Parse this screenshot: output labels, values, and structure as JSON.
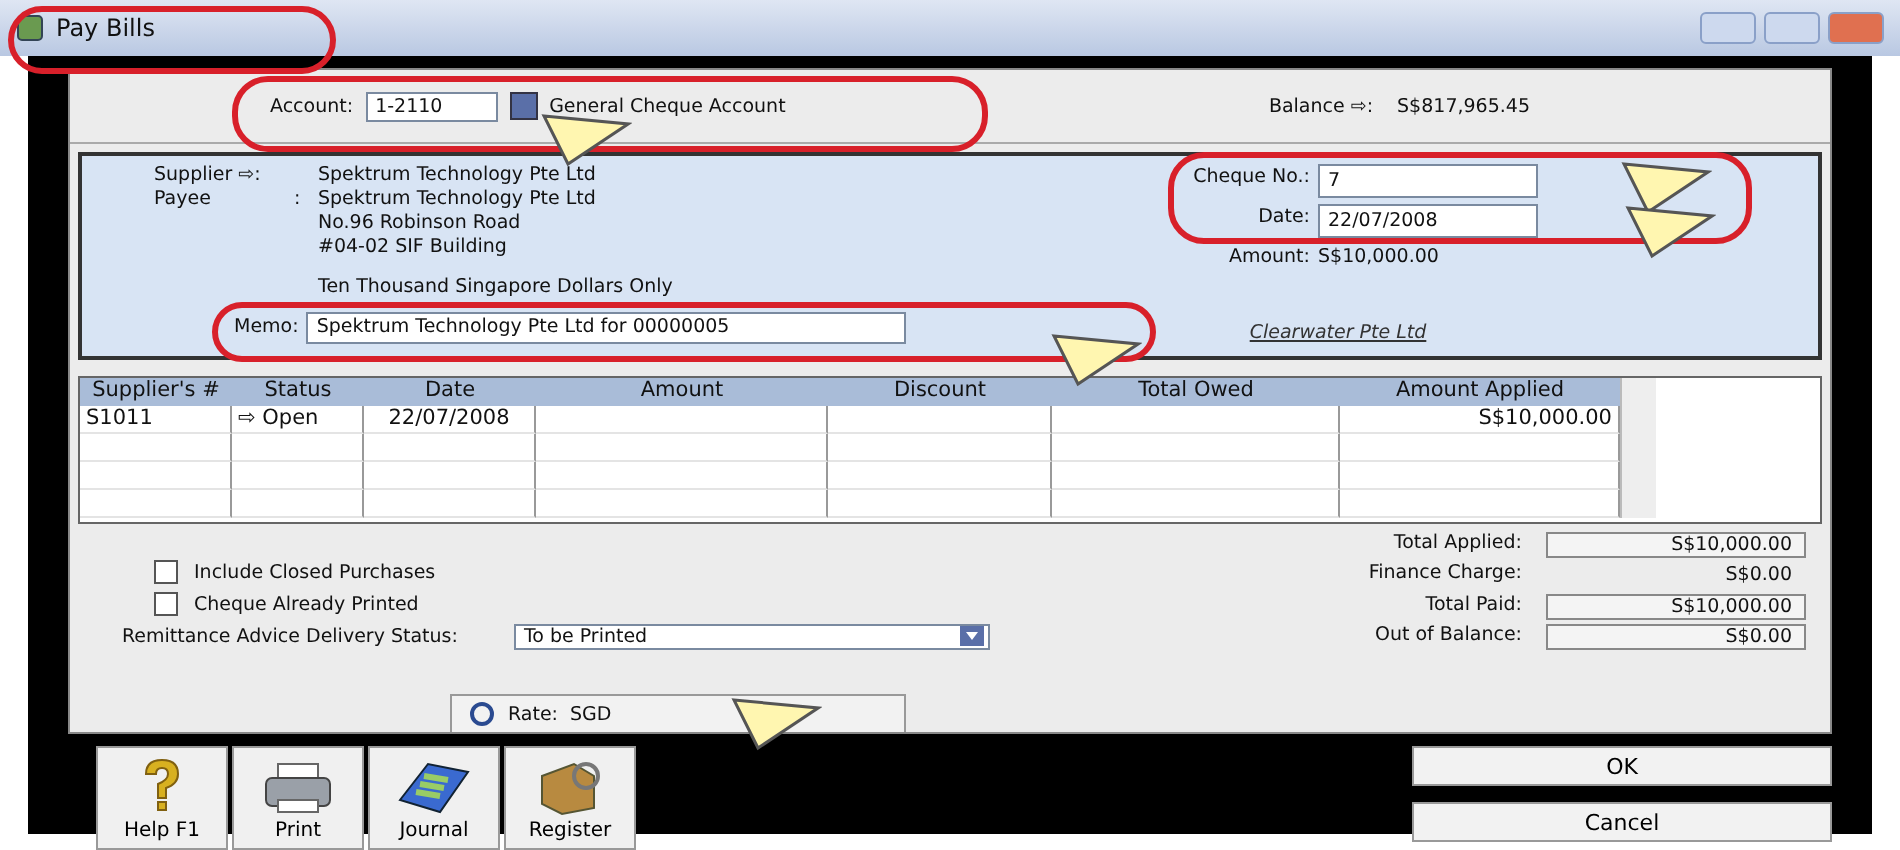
{
  "window": {
    "title": "Pay Bills"
  },
  "account": {
    "label": "Account:",
    "number": "1-2110",
    "name": "General Cheque Account"
  },
  "balance": {
    "label": "Balance ⇨:",
    "value": "S$817,965.45"
  },
  "cheque": {
    "supplier_label": "Supplier ⇨:",
    "supplier": "Spektrum Technology Pte Ltd",
    "payee_label": "Payee",
    "payee_colon": ":",
    "payee_lines": [
      "Spektrum Technology Pte Ltd",
      "No.96 Robinson Road",
      "#04-02 SIF Building"
    ],
    "amount_words": "Ten Thousand Singapore Dollars Only",
    "memo_label": "Memo:",
    "memo": "Spektrum Technology Pte Ltd for 00000005",
    "cheque_no_label": "Cheque No.:",
    "cheque_no": "7",
    "date_label": "Date:",
    "date": "22/07/2008",
    "amount_label": "Amount:",
    "amount": "S$10,000.00",
    "signature": "Clearwater Pte Ltd"
  },
  "table": {
    "columns": [
      "Supplier's #",
      "Status",
      "Date",
      "Amount",
      "Discount",
      "Total Owed",
      "Amount Applied"
    ],
    "rows": [
      {
        "cells": [
          "S1011",
          "⇨ Open",
          "22/07/2008",
          "",
          "",
          "",
          "S$10,000.00"
        ]
      }
    ]
  },
  "options": [
    {
      "label": "Include Closed Purchases",
      "checked": false
    },
    {
      "label": "Cheque Already Printed",
      "checked": false
    }
  ],
  "remittance": {
    "label": "Remittance Advice Delivery Status:",
    "value": "To be Printed"
  },
  "totals": [
    {
      "label": "Total Applied:",
      "value": "S$10,000.00",
      "kind": "boxed"
    },
    {
      "label": "Finance Charge:",
      "value": "S$0.00",
      "kind": "plain"
    },
    {
      "label": "Total Paid:",
      "value": "S$10,000.00",
      "kind": "boxed"
    },
    {
      "label": "Out of Balance:",
      "value": "S$0.00",
      "kind": "boxed"
    }
  ],
  "rate": {
    "label": "Rate:",
    "value": "SGD"
  },
  "toolbar": [
    {
      "label": "Help F1",
      "kind": "help"
    },
    {
      "label": "Print",
      "kind": "print"
    },
    {
      "label": "Journal",
      "kind": "journal"
    },
    {
      "label": "Register",
      "kind": "register"
    }
  ],
  "buttons": [
    "OK",
    "Cancel"
  ]
}
